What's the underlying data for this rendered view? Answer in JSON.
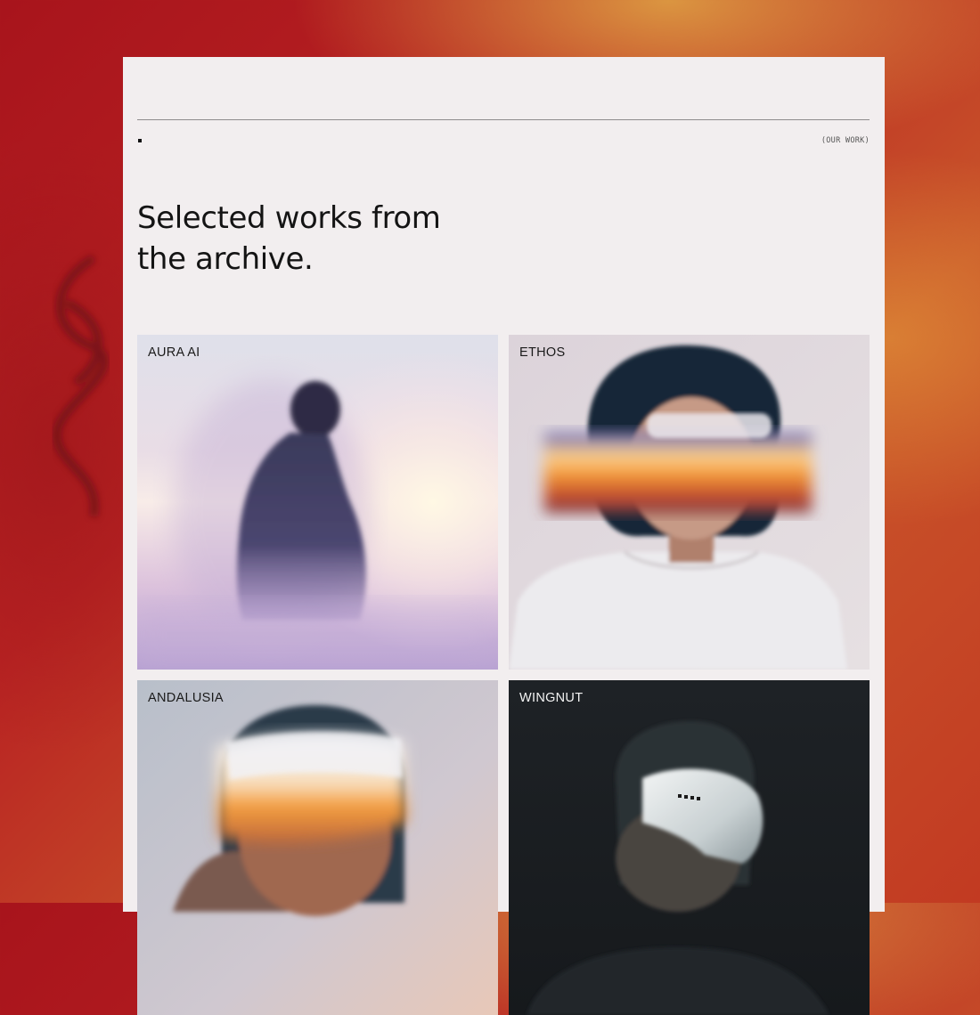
{
  "section": {
    "label": "(OUR WORK)",
    "headline_line1": "Selected works from",
    "headline_line2": "the archive."
  },
  "works": [
    {
      "title": "AURA AI",
      "image": "blurred-figure-in-coat-image"
    },
    {
      "title": "ETHOS",
      "image": "person-with-light-visor-image"
    },
    {
      "title": "ANDALUSIA",
      "image": "person-with-glowing-headset-image"
    },
    {
      "title": "WINGNUT",
      "image": "person-with-vr-headset-dark-image"
    }
  ],
  "colors": {
    "page_background": "#b82222",
    "card_background": "#f2eeef",
    "text": "#141414",
    "rule": "#8e8b8c"
  }
}
